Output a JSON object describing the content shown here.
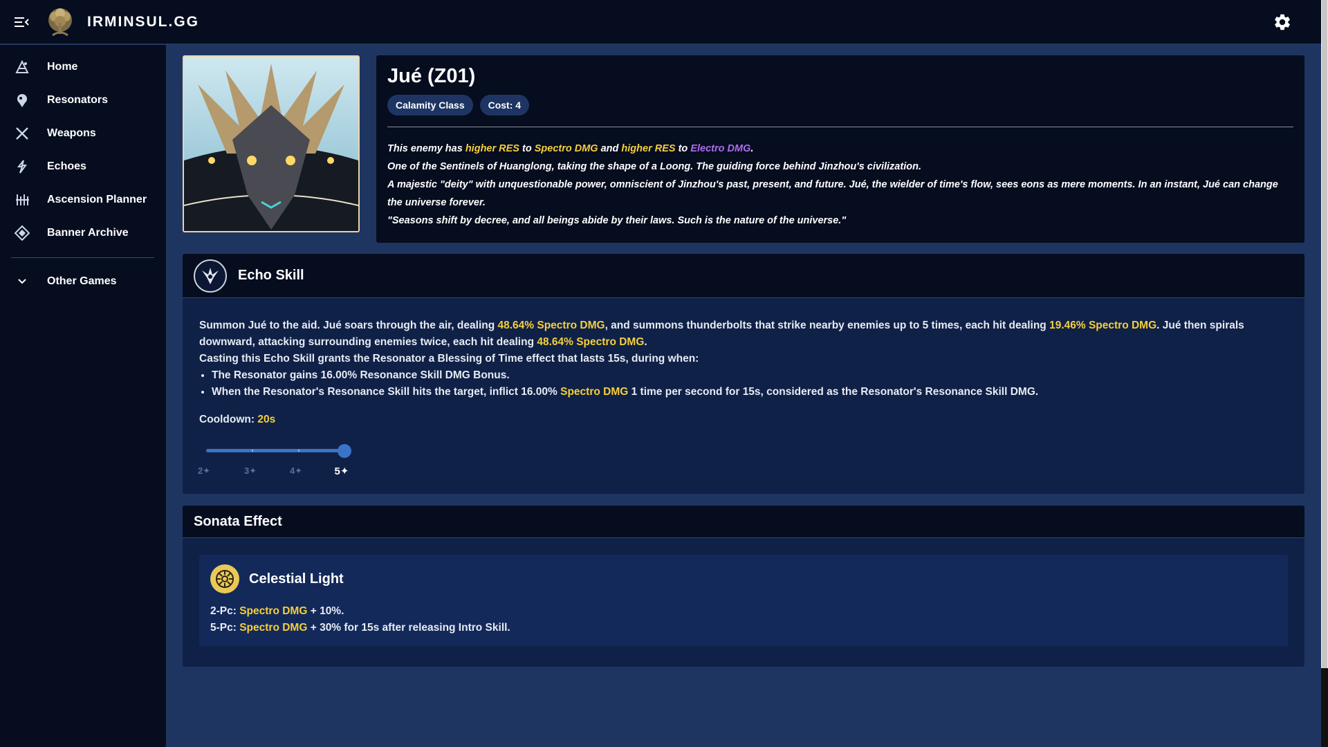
{
  "app": {
    "brand": "IRMINSUL.GG",
    "accent_color": "#f6cf3b",
    "electro_color": "#b06af0",
    "slider_color": "#3b73c9"
  },
  "sidebar": {
    "items": [
      {
        "label": "Home",
        "icon": "home-icon"
      },
      {
        "label": "Resonators",
        "icon": "resonators-icon"
      },
      {
        "label": "Weapons",
        "icon": "weapons-icon"
      },
      {
        "label": "Echoes",
        "icon": "echoes-icon"
      },
      {
        "label": "Ascension Planner",
        "icon": "ascension-icon"
      },
      {
        "label": "Banner Archive",
        "icon": "banner-icon"
      }
    ],
    "other_games": {
      "label": "Other Games",
      "icon": "chevron-down-icon"
    }
  },
  "enemy": {
    "name": "Jué (Z01)",
    "class_chip": "Calamity Class",
    "cost_chip": "Cost: 4",
    "res_line": {
      "prefix": "This enemy has ",
      "res1": "higher RES",
      "to1": " to ",
      "elem1": "Spectro DMG",
      "and": " and ",
      "res2": "higher RES",
      "to2": " to ",
      "elem2": "Electro DMG",
      "end": "."
    },
    "lore": [
      "One of the Sentinels of Huanglong, taking the shape of a Loong. The guiding force behind Jinzhou's civilization.",
      "A majestic \"deity\" with unquestionable power, omniscient of Jinzhou's past, present, and future. Jué, the wielder of time's flow, sees eons as mere moments. In an instant, Jué can change the universe forever.",
      "\"Seasons shift by decree, and all beings abide by their laws. Such is the nature of the universe.\""
    ]
  },
  "echo_skill": {
    "title": "Echo Skill",
    "p1": {
      "a": "Summon Jué to the aid. Jué soars through the air, dealing ",
      "h1": "48.64% Spectro DMG",
      "b": ", and summons thunderbolts that strike nearby enemies up to 5 times, each hit dealing ",
      "h2": "19.46% Spectro DMG",
      "c": ". Jué then spirals downward, attacking surrounding enemies twice, each hit dealing ",
      "h3": "48.64% Spectro DMG",
      "d": "."
    },
    "p2": "Casting this Echo Skill grants the Resonator a Blessing of Time effect that lasts 15s, during when:",
    "bullet1": "The Resonator gains 16.00% Resonance Skill DMG Bonus.",
    "bullet2": {
      "a": "When the Resonator's Resonance Skill hits the target, inflict 16.00% ",
      "h": "Spectro DMG",
      "b": " 1 time per second for 15s, considered as the Resonator's Resonance Skill DMG."
    },
    "cooldown_label": "Cooldown: ",
    "cooldown_value": "20s",
    "rarity_marks": [
      "2✦",
      "3✦",
      "4✦",
      "5✦"
    ],
    "selected_rarity": "5✦"
  },
  "sonata": {
    "title": "Sonata Effect",
    "set_name": "Celestial Light",
    "pc2": {
      "label": "2-Pc: ",
      "h": "Spectro DMG",
      "rest": " + 10%."
    },
    "pc5": {
      "label": "5-Pc: ",
      "h": "Spectro DMG",
      "rest": " + 30% for 15s after releasing Intro Skill."
    }
  }
}
